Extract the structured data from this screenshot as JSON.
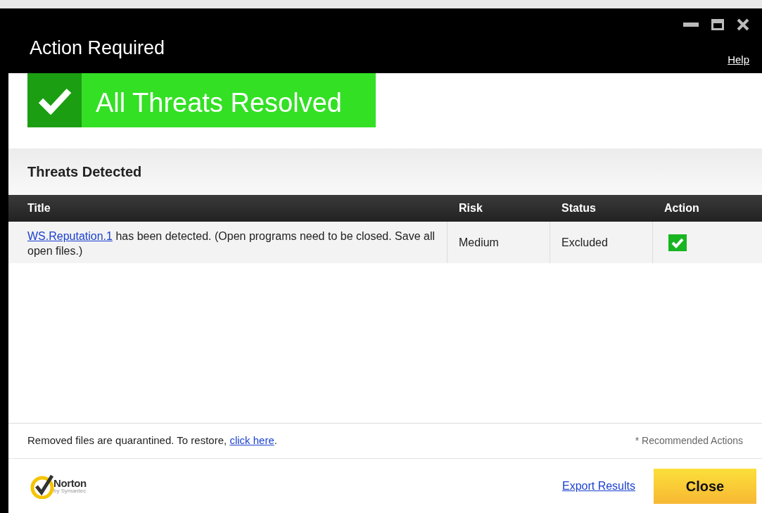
{
  "window": {
    "title": "Action Required",
    "help": "Help"
  },
  "banner": {
    "text": "All Threats Resolved"
  },
  "section": {
    "title": "Threats Detected"
  },
  "table": {
    "columns": [
      "Title",
      "Risk",
      "Status",
      "Action"
    ],
    "rows": [
      {
        "link": "WS.Reputation.1",
        "title": "has been detected. (Open programs need to be closed. Save all open files.)",
        "risk": "Medium",
        "status": "Excluded",
        "checked": true
      }
    ]
  },
  "footer": {
    "note": "Removed files are quarantined. To restore,",
    "link": "click here",
    "note_end": ".",
    "legend": "* Recommended Actions"
  },
  "brand": {
    "name": "Norton",
    "sub": "by Symantec"
  },
  "actions": {
    "export": "Export Results",
    "close": "Close"
  }
}
